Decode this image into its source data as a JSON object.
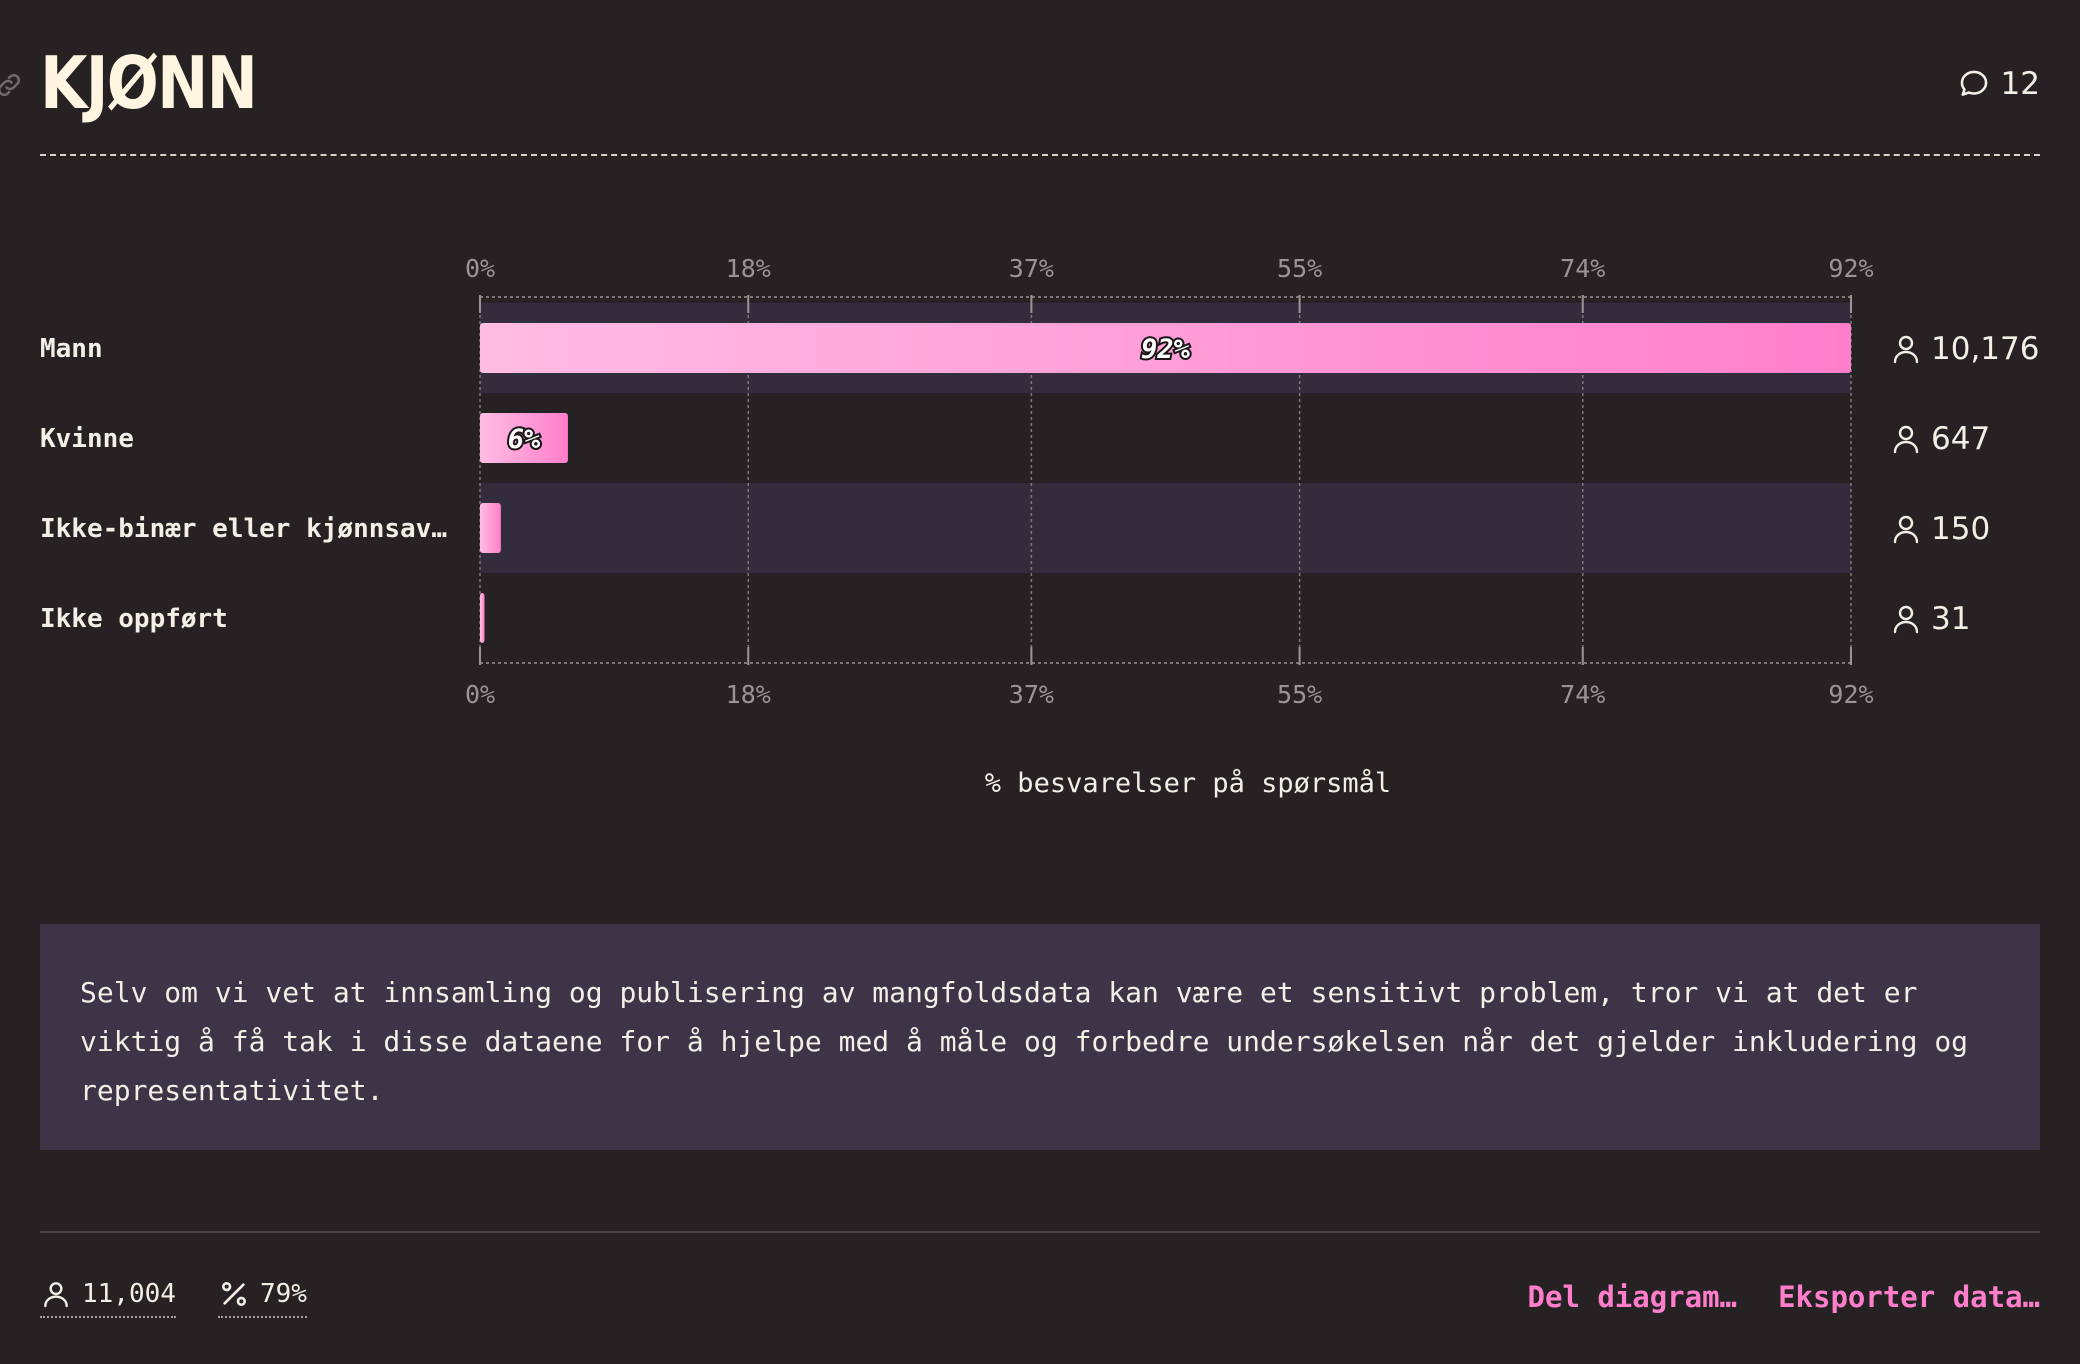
{
  "header": {
    "title": "KJØNN",
    "comment_count": "12"
  },
  "chart_data": {
    "type": "bar",
    "orientation": "horizontal",
    "categories": [
      "Mann",
      "Kvinne",
      "Ikke-binær eller kjønnsav…",
      "Ikke oppført"
    ],
    "values": [
      92,
      5.9,
      1.4,
      0.3
    ],
    "value_labels": [
      "92%",
      "6%",
      "",
      ""
    ],
    "counts": [
      "10,176",
      "647",
      "150",
      "31"
    ],
    "ticks": [
      "0%",
      "18%",
      "37%",
      "55%",
      "74%",
      "92%"
    ],
    "xlim": [
      0,
      92
    ],
    "xlabel": "% besvarelser på spørsmål",
    "grid": true,
    "bar_gradient": [
      "#ffbde3",
      "#ff7ecb"
    ],
    "stripe_color": "#332c3d"
  },
  "note": {
    "text": "Selv om vi vet at innsamling og publisering av mangfoldsdata kan være et sensitivt problem, tror vi at det er viktig å få tak i disse dataene for å hjelpe med å måle og forbedre undersøkelsen når det gjelder inkludering og representativitet."
  },
  "footer": {
    "respondents": "11,004",
    "response_rate": "79%",
    "share_label": "Del diagram…",
    "export_label": "Eksporter data…"
  },
  "icons": {
    "link": "link-icon",
    "comment": "comment-bubble-icon",
    "user": "user-icon",
    "percent": "percent-icon"
  },
  "colors": {
    "background": "#262223",
    "accent": "#ff7ecb",
    "note_background": "#3b3547",
    "title": "#fff5e1"
  }
}
